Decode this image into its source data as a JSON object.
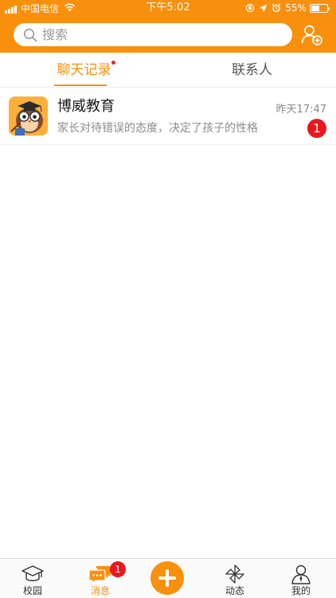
{
  "status_bar": {
    "carrier": "中国电信",
    "time": "下午5:02",
    "battery": "55%",
    "battery_level": 0.55
  },
  "search": {
    "placeholder": "搜索",
    "icon": "search-icon"
  },
  "header": {
    "add_contact_icon": "add-contact-icon"
  },
  "tabs": [
    {
      "label": "聊天记录",
      "active": true,
      "has_dot": true
    },
    {
      "label": "联系人",
      "active": false
    }
  ],
  "chats": [
    {
      "name": "博威教育",
      "preview": "家长对待错误的态度，决定了孩子的性格",
      "time": "昨天17:47",
      "unread": "1",
      "avatar": "owl-teacher-avatar"
    }
  ],
  "tab_bar": {
    "items": [
      {
        "label": "校园",
        "icon": "graduation-cap-icon"
      },
      {
        "label": "消息",
        "icon": "chat-bubbles-icon",
        "active": true,
        "badge": "1"
      },
      {
        "label": "",
        "icon": "plus-icon"
      },
      {
        "label": "动态",
        "icon": "pinwheel-icon"
      },
      {
        "label": "我的",
        "icon": "profile-icon"
      }
    ]
  },
  "colors": {
    "accent": "#f8900e",
    "badge": "#e8191e"
  }
}
